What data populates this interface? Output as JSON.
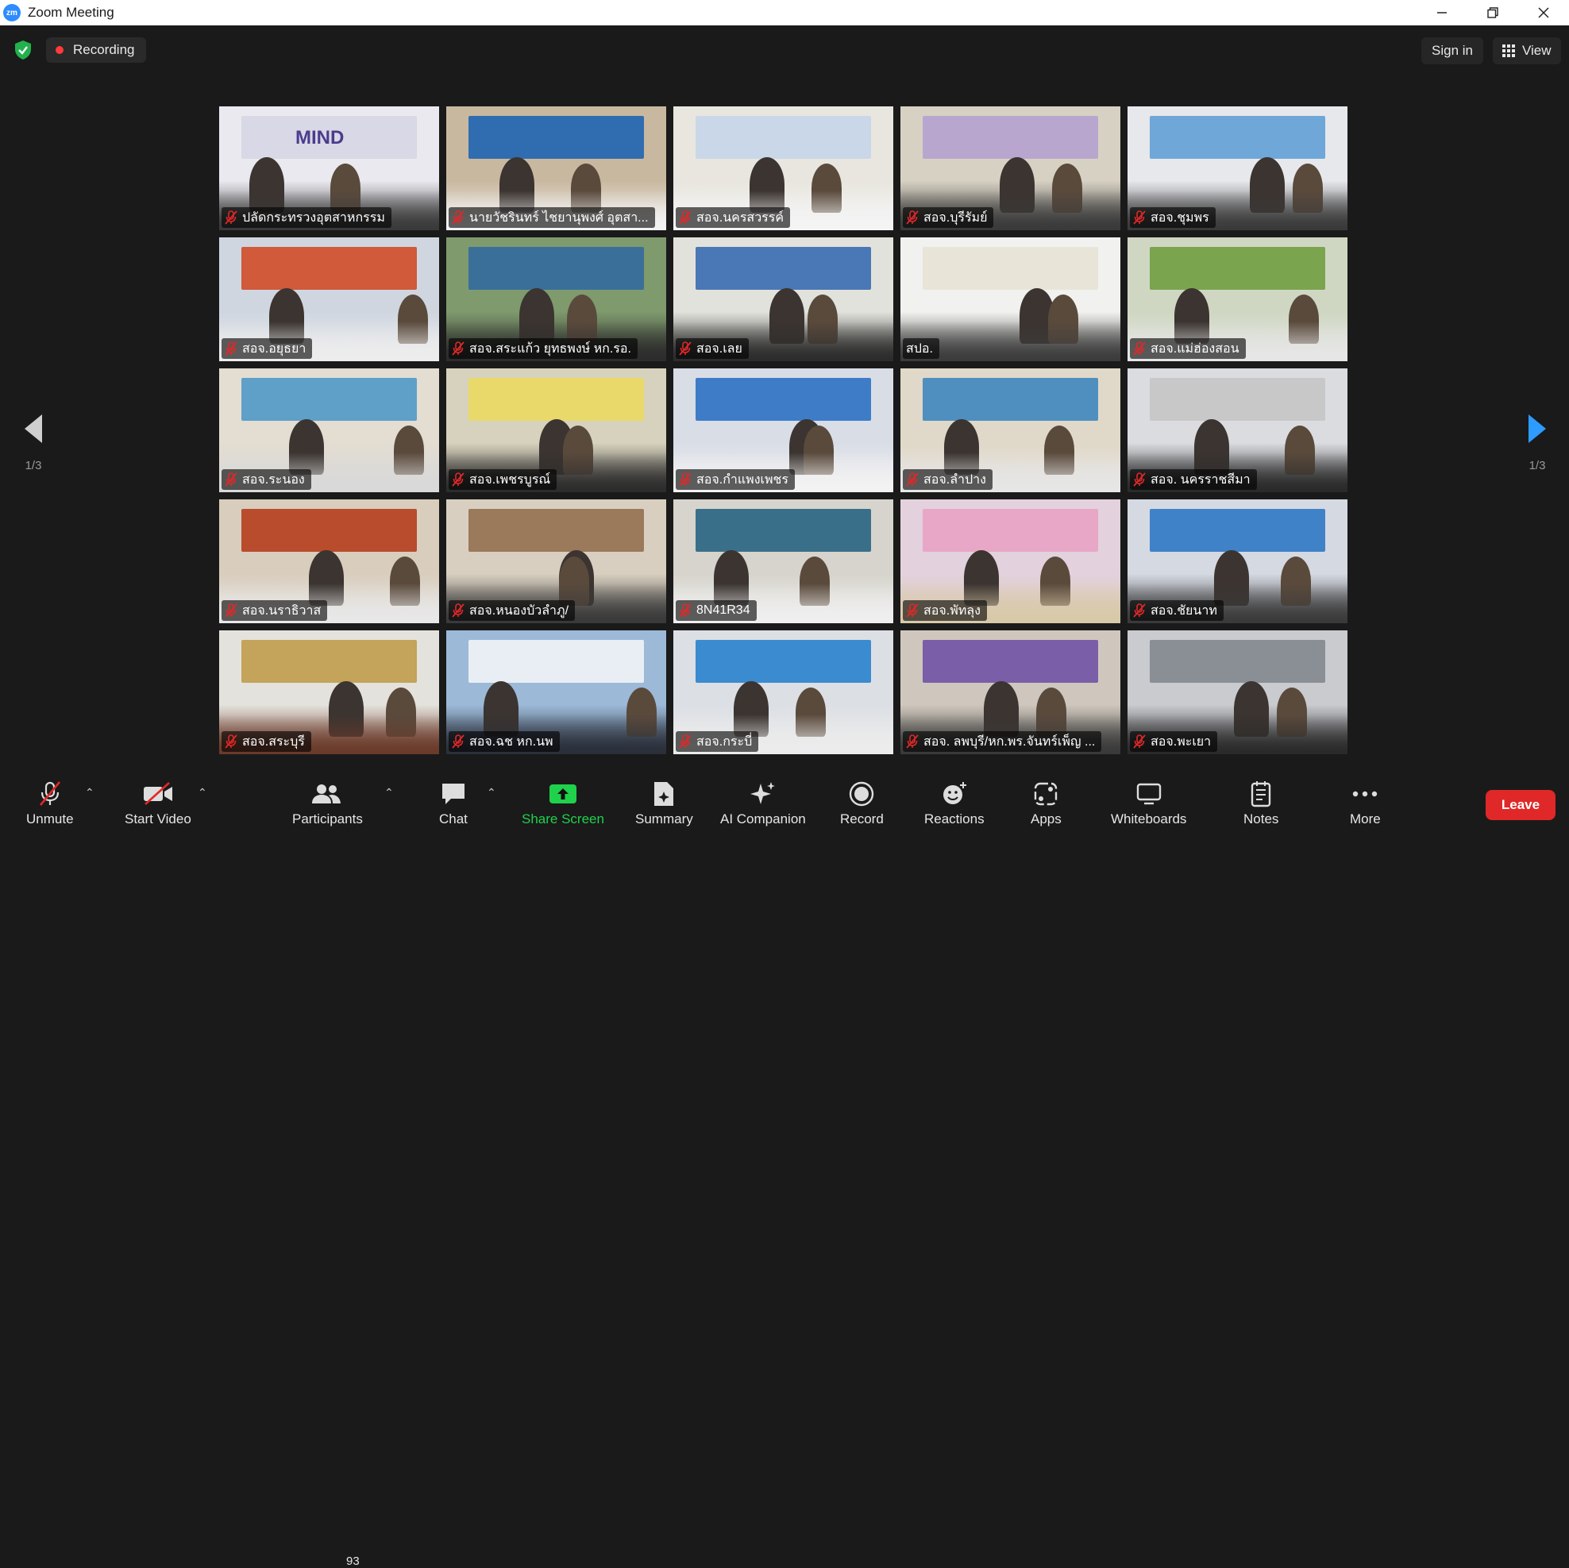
{
  "window": {
    "title": "Zoom Meeting",
    "logo_text": "zm"
  },
  "top": {
    "recording_label": "Recording",
    "sign_in_label": "Sign in",
    "view_label": "View"
  },
  "pager": {
    "left_text": "1/3",
    "right_text": "1/3"
  },
  "participants": [
    {
      "name": "ปลัดกระทรวงอุตสาหกรรม",
      "muted": true,
      "logo_text": "MIND"
    },
    {
      "name": "นายวัชรินทร์ ไชยานุพงศ์ อุตสา...",
      "muted": true
    },
    {
      "name": "สอจ.นครสวรรค์",
      "muted": true
    },
    {
      "name": "สอจ.บุรีรัมย์",
      "muted": true
    },
    {
      "name": "สอจ.ชุมพร",
      "muted": true
    },
    {
      "name": "สอจ.อยุธยา",
      "muted": true
    },
    {
      "name": "สอจ.สระแก้ว ยุทธพงษ์ หก.รอ.",
      "muted": true
    },
    {
      "name": "สอจ.เลย",
      "muted": true
    },
    {
      "name": "สปอ.",
      "muted": false
    },
    {
      "name": "สอจ.แม่ฮ่องสอน",
      "muted": true
    },
    {
      "name": "สอจ.ระนอง",
      "muted": true
    },
    {
      "name": "สอจ.เพชรบูรณ์",
      "muted": true
    },
    {
      "name": "สอจ.กำแพงเพชร",
      "muted": true
    },
    {
      "name": "สอจ.ลำปาง",
      "muted": true
    },
    {
      "name": "สอจ. นครราชสีมา",
      "muted": true
    },
    {
      "name": "สอจ.นราธิวาส",
      "muted": true
    },
    {
      "name": "สอจ.หนองบัวลำภู/",
      "muted": true
    },
    {
      "name": "8N41R34",
      "muted": true
    },
    {
      "name": "สอจ.พัทลุง",
      "muted": true
    },
    {
      "name": "สอจ.ชัยนาท",
      "muted": true
    },
    {
      "name": "สอจ.สระบุรี",
      "muted": true
    },
    {
      "name": "สอจ.ฉช หก.นพ",
      "muted": true
    },
    {
      "name": "สอจ.กระบี่",
      "muted": true
    },
    {
      "name": "สอจ. ลพบุรี/หก.พร.จันทร์เพ็ญ ...",
      "muted": true
    },
    {
      "name": "สอจ.พะเยา",
      "muted": true
    }
  ],
  "toolbar": {
    "unmute": "Unmute",
    "start_video": "Start Video",
    "participants": "Participants",
    "participants_count": "93",
    "chat": "Chat",
    "share_screen": "Share Screen",
    "summary": "Summary",
    "ai_companion": "AI Companion",
    "record": "Record",
    "reactions": "Reactions",
    "apps": "Apps",
    "whiteboards": "Whiteboards",
    "notes": "Notes",
    "more": "More",
    "leave": "Leave"
  },
  "colors": {
    "accent": "#2d8cff",
    "leave": "#e02828",
    "share": "#1fd14b",
    "recording": "#ff3b3b"
  }
}
